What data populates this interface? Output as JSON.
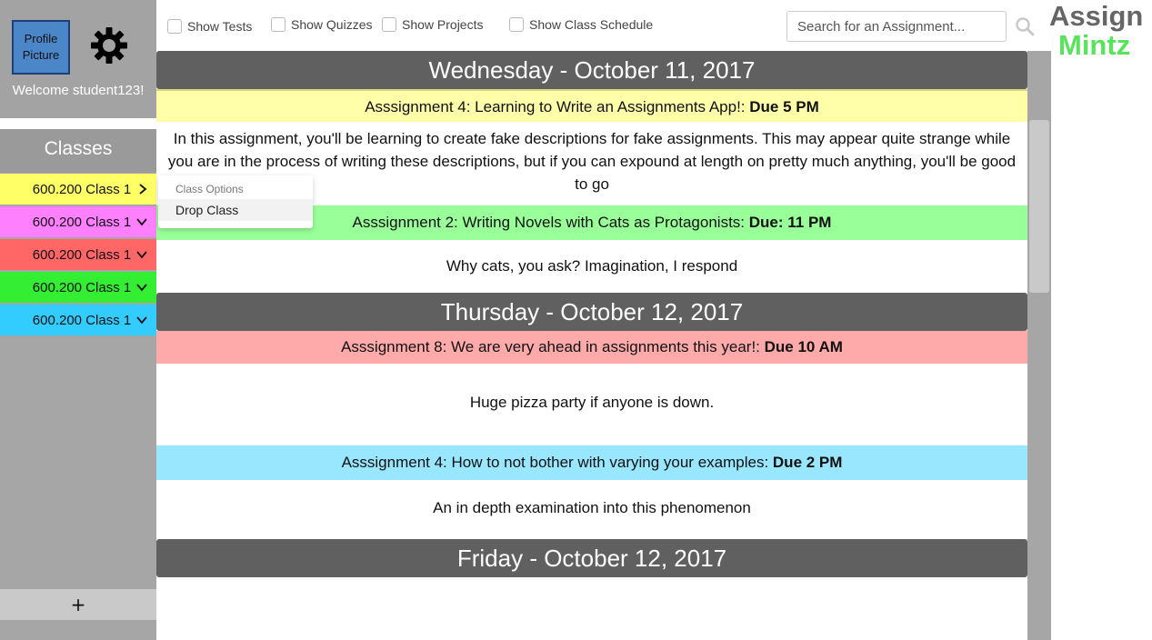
{
  "sidebar": {
    "profile_label_1": "Profile",
    "profile_label_2": "Picture",
    "welcome": "Welcome student123!",
    "classes_header": "Classes",
    "classes": [
      {
        "label": "600.200 Class 1",
        "color": "#ffff66",
        "chevron": "›"
      },
      {
        "label": "600.200 Class 1",
        "color": "#ff80ff",
        "chevron": "⌄"
      },
      {
        "label": "600.200 Class 1",
        "color": "#ff6666",
        "chevron": "⌄"
      },
      {
        "label": "600.200 Class 1",
        "color": "#33ee33",
        "chevron": "⌄"
      },
      {
        "label": "600.200 Class 1",
        "color": "#33ccff",
        "chevron": "⌄"
      }
    ],
    "add_label": "+"
  },
  "dropdown": {
    "header": "Class Options",
    "item": "Drop Class"
  },
  "filters": {
    "tests": "Show Tests",
    "quizzes": "Show Quizzes",
    "projects": "Show Projects",
    "schedule": "Show Class Schedule"
  },
  "search": {
    "placeholder": "Search for an Assignment..."
  },
  "logo": {
    "line1": "Assign",
    "line2": "Mintz"
  },
  "days": [
    {
      "title": "Wednesday - October 11, 2017",
      "assignments": [
        {
          "title": "Asssignment 4: Learning to Write an Assignments App!: ",
          "due": "Due 5 PM",
          "color": "#ffffaa",
          "description": "In this assignment, you'll be learning to create fake descriptions for fake assignments. This may appear quite strange while you are in the process of writing these descriptions, but if you can expound at length on pretty much anything, you'll be good to go"
        },
        {
          "title": "Asssignment 2: Writing Novels with Cats as Protagonists: ",
          "due": "Due: 11 PM",
          "color": "#99ff99",
          "description": "Why cats, you ask? Imagination, I respond"
        }
      ]
    },
    {
      "title": "Thursday - October 12, 2017",
      "assignments": [
        {
          "title": "Asssignment 8: We are very ahead in assignments this year!: ",
          "due": "Due 10 AM",
          "color": "#ffaaaa",
          "description": "Huge pizza party if anyone is down."
        },
        {
          "title": "Asssignment 4: How to not bother with varying your examples: ",
          "due": "Due 2 PM",
          "color": "#99e6ff",
          "description": "An in depth examination into this phenomenon"
        }
      ]
    },
    {
      "title": "Friday - October 12, 2017",
      "assignments": []
    }
  ]
}
